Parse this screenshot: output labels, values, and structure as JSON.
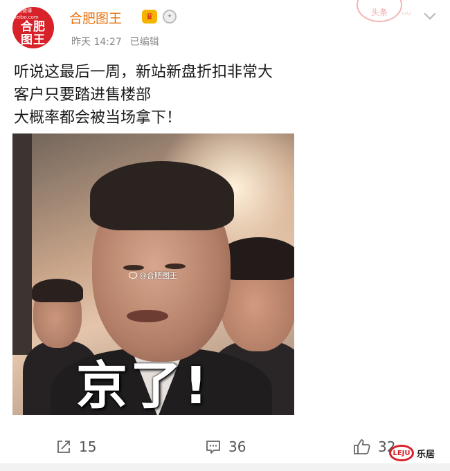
{
  "post": {
    "avatar": {
      "small_text": "新浪微博 weibo.com",
      "big_text_1": "合肥",
      "big_text_2": "图王"
    },
    "username": "合肥图王",
    "time": "昨天 14:27",
    "edited": "已编辑",
    "stamp_text": "头条",
    "text_lines": [
      "听说这最后一周，新站新盘折扣非常大",
      "客户只要踏进售楼部",
      "大概率都会被当场拿下！"
    ]
  },
  "image": {
    "watermark": "@合肥图王",
    "caption": "京了!"
  },
  "actions": {
    "reposts": "15",
    "comments": "36",
    "likes": "32"
  },
  "corner_logo": {
    "logo_text": "LEJU",
    "label": "乐居"
  },
  "colors": {
    "username": "#e8700e",
    "avatar_bg": "#d7222a",
    "meta_gray": "#8a8a8a"
  }
}
